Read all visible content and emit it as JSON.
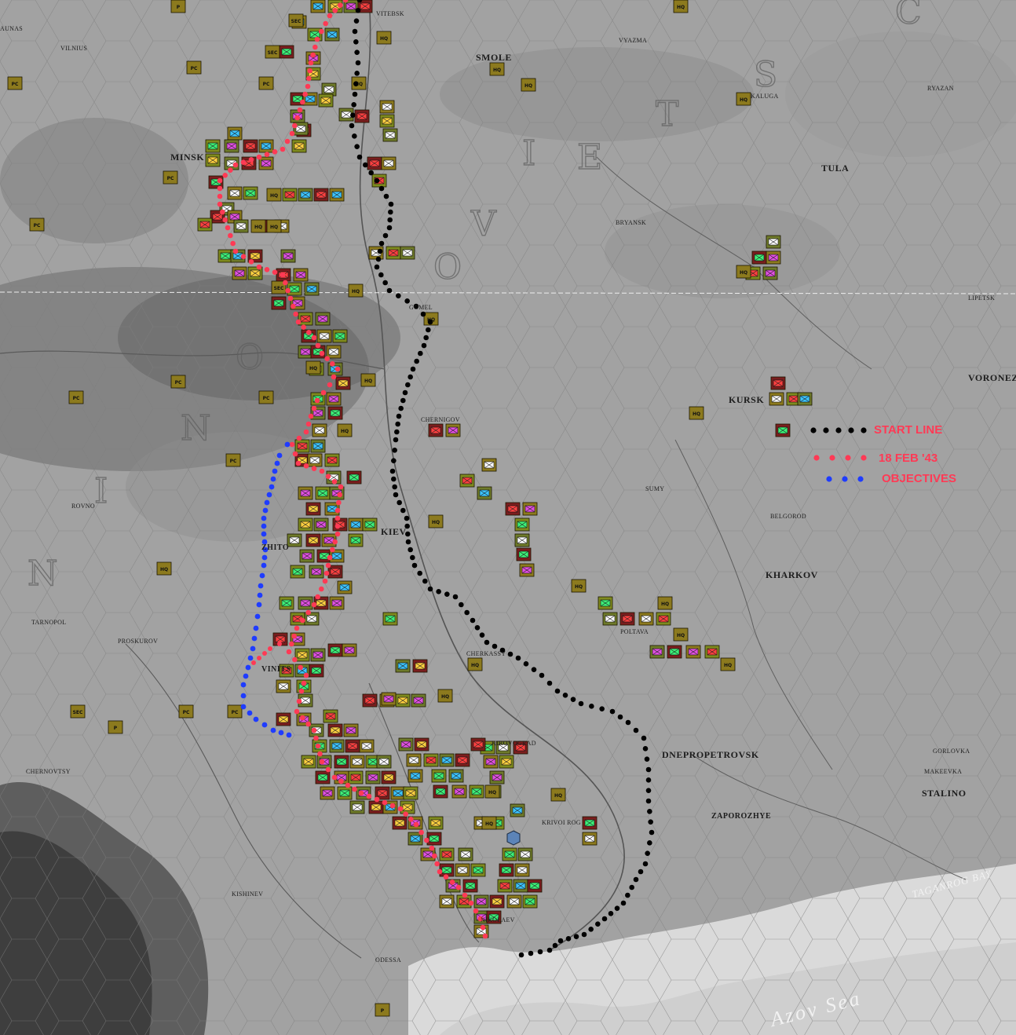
{
  "map": {
    "cities": [
      {
        "name": "VITEBSK",
        "key": "vitebsk"
      },
      {
        "name": "VILNIUS",
        "key": "vilnius"
      },
      {
        "name": "AUNAS",
        "key": "kaunas"
      },
      {
        "name": "MINSK",
        "key": "minsk"
      },
      {
        "name": "SMOLE",
        "key": "smolensk"
      },
      {
        "name": "VYAZMA",
        "key": "vyazma"
      },
      {
        "name": "KALUGA",
        "key": "kaluga"
      },
      {
        "name": "RYAZAN",
        "key": "ryazan"
      },
      {
        "name": "TULA",
        "key": "tula"
      },
      {
        "name": "BRYANSK",
        "key": "bryansk"
      },
      {
        "name": "GOMEL",
        "key": "gomel"
      },
      {
        "name": "LIPETSK",
        "key": "lipetsk"
      },
      {
        "name": "VORONEZH",
        "key": "voronezh"
      },
      {
        "name": "KURSK",
        "key": "kursk"
      },
      {
        "name": "CHERNIGOV",
        "key": "chernigov"
      },
      {
        "name": "SUMY",
        "key": "sumy"
      },
      {
        "name": "BELGOROD",
        "key": "belgorod"
      },
      {
        "name": "KHARKOV",
        "key": "kharkov"
      },
      {
        "name": "KIEV",
        "key": "kiev"
      },
      {
        "name": "ROVNO",
        "key": "rovno"
      },
      {
        "name": "ZHITO",
        "key": "zhitomir"
      },
      {
        "name": "TARNOPOL",
        "key": "tarnopol"
      },
      {
        "name": "PROSKUROV",
        "key": "proskurov"
      },
      {
        "name": "POLTAVA",
        "key": "poltava"
      },
      {
        "name": "CHERKASSY",
        "key": "cherkassy"
      },
      {
        "name": "VINITS",
        "key": "vinnitsa"
      },
      {
        "name": "KIROVOGRAD",
        "key": "kirovograd"
      },
      {
        "name": "DNEPROPETROVSK",
        "key": "dnepropetrovsk"
      },
      {
        "name": "GORLOVKA",
        "key": "gorlovka"
      },
      {
        "name": "MAKEEVKA",
        "key": "makeevka"
      },
      {
        "name": "STALINO",
        "key": "stalino"
      },
      {
        "name": "ZAPOROZHYE",
        "key": "zaporozhye"
      },
      {
        "name": "KRIVOI ROG",
        "key": "krivoirog"
      },
      {
        "name": "CHERNOVTSY",
        "key": "chernovtsy"
      },
      {
        "name": "KISHINEV",
        "key": "kishinev"
      },
      {
        "name": "NIKOLAEV",
        "key": "nikolaev"
      },
      {
        "name": "ODESSA",
        "key": "odessa"
      }
    ],
    "seas": {
      "azov": "Azov Sea",
      "taganrog": "TAGANROG BAY"
    },
    "legend": {
      "start_line": "START LINE",
      "date_line": "18 FEB '43",
      "objectives": "OBJECTIVES"
    },
    "colors": {
      "start_line": "#000000",
      "date_line": "#ff3a55",
      "objectives": "#1f3cff"
    },
    "counter_labels": [
      "HQ",
      "PC",
      "SEC",
      "P"
    ]
  }
}
